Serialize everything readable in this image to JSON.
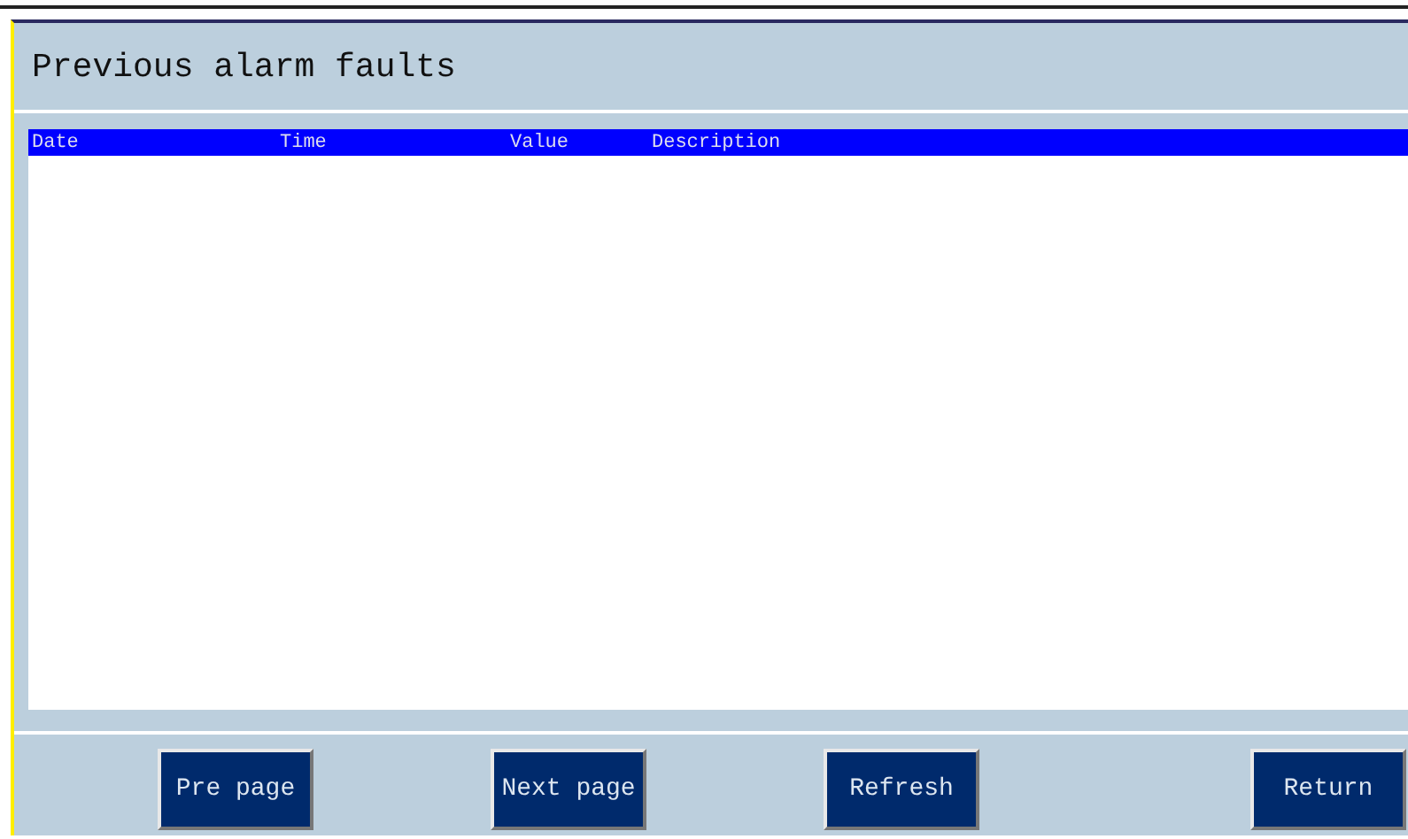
{
  "window": {
    "title": "Previous alarm faults"
  },
  "table": {
    "columns": [
      "Date",
      "Time",
      "Value",
      "Description"
    ]
  },
  "buttons": [
    "Pre page",
    "Next page",
    "Refresh",
    "Return"
  ]
}
